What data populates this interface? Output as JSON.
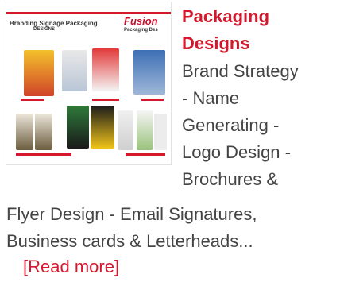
{
  "thumbnail": {
    "header_text": "Branding Signage Packaging",
    "header_sub": "DESIGNS",
    "brand": "Fusion",
    "brand_sub": "Packaging Des"
  },
  "title": [
    "Packaging",
    "Designs"
  ],
  "description_right": [
    "Brand Strategy",
    "- Name",
    "Generating -",
    "Logo Design -",
    "Brochures &"
  ],
  "description_full": [
    "Flyer Design - Email Signatures,",
    "Business cards & Letterheads..."
  ],
  "read_more": "[Read more]",
  "colors": {
    "accent": "#d6182e",
    "text": "#444444"
  }
}
